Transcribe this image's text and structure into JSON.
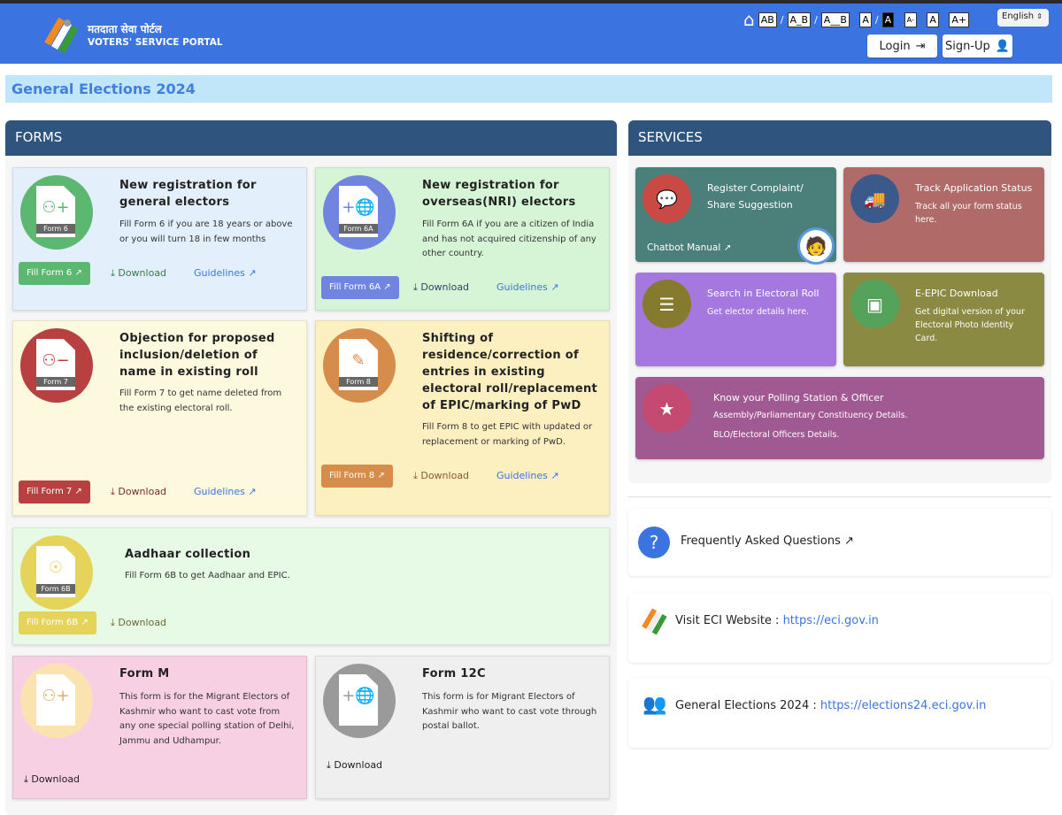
{
  "header": {
    "brand_hindi": "मतदाता सेवा पोर्टल",
    "brand_english": "VOTERS' SERVICE PORTAL",
    "accessibility": [
      "AB",
      "A_B",
      "A__B",
      "A",
      "A",
      "A-",
      "A",
      "A+"
    ],
    "language": "English",
    "login": "Login",
    "signup": "Sign-Up"
  },
  "banner": "General Elections 2024",
  "forms": {
    "title": "FORMS",
    "cards": [
      {
        "badge": "Form 6",
        "title": "New registration for general electors",
        "desc": "Fill Form 6 if you are 18 years or above or you will turn 18 in few months",
        "fill": "Fill Form 6",
        "download": "Download",
        "guidelines": "Guidelines",
        "color": "#5cb870",
        "bg": "#e3f0fb"
      },
      {
        "badge": "Form 6A",
        "title": "New registration for overseas(NRI) electors",
        "desc": "Fill Form 6A if you are a citizen of India and has not acquired citizenship of any other country.",
        "fill": "Fill Form 6A",
        "download": "Download",
        "guidelines": "Guidelines",
        "color": "#6f85e0",
        "bg": "#d6f5d6"
      },
      {
        "badge": "Form 7",
        "title": "Objection for proposed inclusion/deletion of name in existing roll",
        "desc": "Fill Form 7 to get name deleted from the existing electoral roll.",
        "fill": "Fill Form 7",
        "download": "Download",
        "guidelines": "Guidelines",
        "color": "#b84040",
        "bg": "#fcf9de"
      },
      {
        "badge": "Form 8",
        "title": "Shifting of residence/correction of entries in existing electoral roll/replacement of EPIC/marking of PwD",
        "desc": "Fill Form 8 to get EPIC with updated or replacement or marking of PwD.",
        "fill": "Fill Form 8",
        "download": "Download",
        "guidelines": "Guidelines",
        "color": "#d68c4a",
        "bg": "#fcefc0"
      },
      {
        "badge": "Form 6B",
        "title": "Aadhaar collection",
        "desc": "Fill Form 6B to get Aadhaar and EPIC.",
        "fill": "Fill Form 6B",
        "download": "Download",
        "color": "#e6d35a",
        "bg": "#e6fae6"
      },
      {
        "title": "Form M",
        "desc": "This form is for the Migrant Electors of Kashmir who want to cast vote from any one special polling station of Delhi, Jammu and Udhampur.",
        "download": "Download",
        "color": "#fbe3b0",
        "bg": "#f8d0e4"
      },
      {
        "title": "Form 12C",
        "desc": "This form is for Migrant Electors of Kashmir who want to cast vote through postal ballot.",
        "download": "Download",
        "color": "#9a9a9a",
        "bg": "#efefef"
      }
    ]
  },
  "services": {
    "title": "SERVICES",
    "tiles": [
      {
        "title": "Register Complaint/ Share Suggestion",
        "link": "Chatbot Manual",
        "bg": "#4a8079",
        "icon_bg": "#c94a45",
        "icon": "chat-icon"
      },
      {
        "title": "Track Application Status",
        "desc": "Track all your form status here.",
        "bg": "#b06b68",
        "icon_bg": "#3a5a8c",
        "icon": "truck-icon"
      },
      {
        "title": "Search in Electoral Roll",
        "desc": "Get elector details here.",
        "bg": "#a478de",
        "icon_bg": "#857a2e",
        "icon": "search-list-icon"
      },
      {
        "title": "E-EPIC Download",
        "desc": "Get digital version of your Electoral Photo Identity Card.",
        "bg": "#8a8a42",
        "icon_bg": "#55a35a",
        "icon": "id-card-icon"
      },
      {
        "title": "Know your Polling Station & Officer",
        "desc": "Assembly/Parliamentary Constituency Details.",
        "desc2": "BLO/Electoral Officers Details.",
        "bg": "#a05a91",
        "icon_bg": "#c54a72",
        "icon": "shield-star-icon"
      }
    ]
  },
  "info": {
    "faq": "Frequently Asked Questions",
    "eci_label": "Visit ECI Website : ",
    "eci_link": "https://eci.gov.in",
    "ge_label": "General Elections 2024 : ",
    "ge_link": "https://elections24.eci.gov.in"
  }
}
